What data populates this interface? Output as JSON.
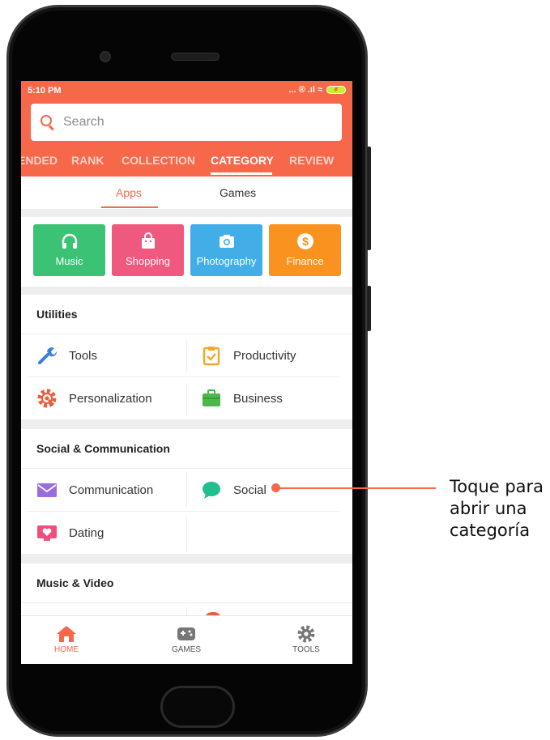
{
  "status_bar": {
    "time": "5:10 PM",
    "icons": "... ® .ıl ≈"
  },
  "search": {
    "placeholder": "Search"
  },
  "top_tabs": [
    {
      "label": "ENDED"
    },
    {
      "label": "RANK"
    },
    {
      "label": "COLLECTION"
    },
    {
      "label": "CATEGORY",
      "active": true
    },
    {
      "label": "REVIEW"
    }
  ],
  "sub_tabs": [
    {
      "label": "Apps",
      "active": true
    },
    {
      "label": "Games"
    }
  ],
  "tiles": [
    {
      "label": "Music",
      "color": "#3cc275",
      "icon": "headphones-icon"
    },
    {
      "label": "Shopping",
      "color": "#f0597f",
      "icon": "shopping-bag-icon"
    },
    {
      "label": "Photography",
      "color": "#42aee8",
      "icon": "camera-icon"
    },
    {
      "label": "Finance",
      "color": "#f9921e",
      "icon": "dollar-icon"
    }
  ],
  "sections": [
    {
      "title": "Utilities",
      "items": [
        {
          "label": "Tools",
          "icon": "wrench-icon"
        },
        {
          "label": "Productivity",
          "icon": "clipboard-check-icon"
        },
        {
          "label": "Personalization",
          "icon": "palette-gear-icon"
        },
        {
          "label": "Business",
          "icon": "briefcase-icon"
        }
      ]
    },
    {
      "title": "Social & Communication",
      "items": [
        {
          "label": "Communication",
          "icon": "envelope-icon"
        },
        {
          "label": "Social",
          "icon": "chat-bubble-icon"
        },
        {
          "label": "Dating",
          "icon": "heart-monitor-icon"
        }
      ]
    },
    {
      "title": "Music & Video"
    }
  ],
  "bottom_nav": [
    {
      "label": "HOME",
      "icon": "home-icon",
      "active": true
    },
    {
      "label": "GAMES",
      "icon": "gamepad-icon"
    },
    {
      "label": "TOOLS",
      "icon": "gear-icon"
    }
  ],
  "callout": {
    "text": "Toque para abrir una categoría"
  },
  "colors": {
    "accent": "#f7674a"
  }
}
